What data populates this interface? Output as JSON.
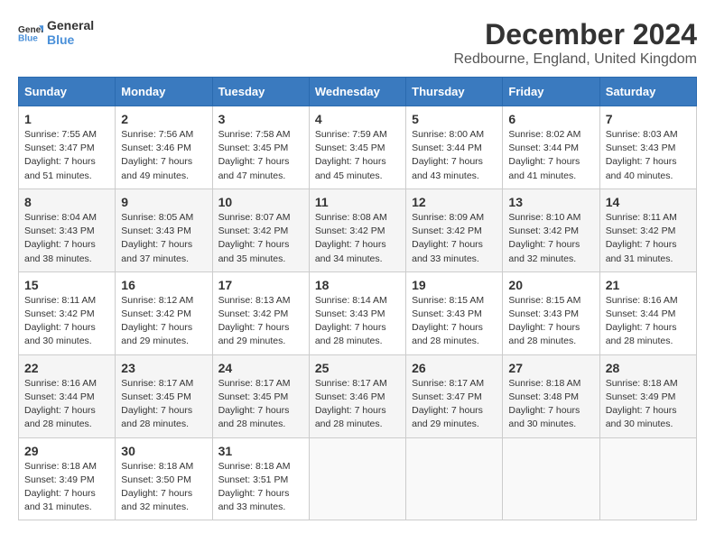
{
  "header": {
    "logo_general": "General",
    "logo_blue": "Blue",
    "month_title": "December 2024",
    "location": "Redbourne, England, United Kingdom"
  },
  "calendar": {
    "days_of_week": [
      "Sunday",
      "Monday",
      "Tuesday",
      "Wednesday",
      "Thursday",
      "Friday",
      "Saturday"
    ],
    "weeks": [
      [
        null,
        {
          "day": "2",
          "sunrise": "7:56 AM",
          "sunset": "3:46 PM",
          "daylight": "7 hours and 49 minutes."
        },
        {
          "day": "3",
          "sunrise": "7:58 AM",
          "sunset": "3:45 PM",
          "daylight": "7 hours and 47 minutes."
        },
        {
          "day": "4",
          "sunrise": "7:59 AM",
          "sunset": "3:45 PM",
          "daylight": "7 hours and 45 minutes."
        },
        {
          "day": "5",
          "sunrise": "8:00 AM",
          "sunset": "3:44 PM",
          "daylight": "7 hours and 43 minutes."
        },
        {
          "day": "6",
          "sunrise": "8:02 AM",
          "sunset": "3:44 PM",
          "daylight": "7 hours and 41 minutes."
        },
        {
          "day": "7",
          "sunrise": "8:03 AM",
          "sunset": "3:43 PM",
          "daylight": "7 hours and 40 minutes."
        }
      ],
      [
        {
          "day": "1",
          "sunrise": "7:55 AM",
          "sunset": "3:47 PM",
          "daylight": "7 hours and 51 minutes."
        },
        {
          "day": "8",
          "sunrise": "8:04 AM",
          "sunset": "3:43 PM",
          "daylight": "7 hours and 38 minutes."
        },
        {
          "day": "9",
          "sunrise": "8:05 AM",
          "sunset": "3:43 PM",
          "daylight": "7 hours and 37 minutes."
        },
        {
          "day": "10",
          "sunrise": "8:07 AM",
          "sunset": "3:42 PM",
          "daylight": "7 hours and 35 minutes."
        },
        {
          "day": "11",
          "sunrise": "8:08 AM",
          "sunset": "3:42 PM",
          "daylight": "7 hours and 34 minutes."
        },
        {
          "day": "12",
          "sunrise": "8:09 AM",
          "sunset": "3:42 PM",
          "daylight": "7 hours and 33 minutes."
        },
        {
          "day": "13",
          "sunrise": "8:10 AM",
          "sunset": "3:42 PM",
          "daylight": "7 hours and 32 minutes."
        },
        {
          "day": "14",
          "sunrise": "8:11 AM",
          "sunset": "3:42 PM",
          "daylight": "7 hours and 31 minutes."
        }
      ],
      [
        {
          "day": "15",
          "sunrise": "8:11 AM",
          "sunset": "3:42 PM",
          "daylight": "7 hours and 30 minutes."
        },
        {
          "day": "16",
          "sunrise": "8:12 AM",
          "sunset": "3:42 PM",
          "daylight": "7 hours and 29 minutes."
        },
        {
          "day": "17",
          "sunrise": "8:13 AM",
          "sunset": "3:42 PM",
          "daylight": "7 hours and 29 minutes."
        },
        {
          "day": "18",
          "sunrise": "8:14 AM",
          "sunset": "3:43 PM",
          "daylight": "7 hours and 28 minutes."
        },
        {
          "day": "19",
          "sunrise": "8:15 AM",
          "sunset": "3:43 PM",
          "daylight": "7 hours and 28 minutes."
        },
        {
          "day": "20",
          "sunrise": "8:15 AM",
          "sunset": "3:43 PM",
          "daylight": "7 hours and 28 minutes."
        },
        {
          "day": "21",
          "sunrise": "8:16 AM",
          "sunset": "3:44 PM",
          "daylight": "7 hours and 28 minutes."
        }
      ],
      [
        {
          "day": "22",
          "sunrise": "8:16 AM",
          "sunset": "3:44 PM",
          "daylight": "7 hours and 28 minutes."
        },
        {
          "day": "23",
          "sunrise": "8:17 AM",
          "sunset": "3:45 PM",
          "daylight": "7 hours and 28 minutes."
        },
        {
          "day": "24",
          "sunrise": "8:17 AM",
          "sunset": "3:45 PM",
          "daylight": "7 hours and 28 minutes."
        },
        {
          "day": "25",
          "sunrise": "8:17 AM",
          "sunset": "3:46 PM",
          "daylight": "7 hours and 28 minutes."
        },
        {
          "day": "26",
          "sunrise": "8:17 AM",
          "sunset": "3:47 PM",
          "daylight": "7 hours and 29 minutes."
        },
        {
          "day": "27",
          "sunrise": "8:18 AM",
          "sunset": "3:48 PM",
          "daylight": "7 hours and 30 minutes."
        },
        {
          "day": "28",
          "sunrise": "8:18 AM",
          "sunset": "3:49 PM",
          "daylight": "7 hours and 30 minutes."
        }
      ],
      [
        {
          "day": "29",
          "sunrise": "8:18 AM",
          "sunset": "3:49 PM",
          "daylight": "7 hours and 31 minutes."
        },
        {
          "day": "30",
          "sunrise": "8:18 AM",
          "sunset": "3:50 PM",
          "daylight": "7 hours and 32 minutes."
        },
        {
          "day": "31",
          "sunrise": "8:18 AM",
          "sunset": "3:51 PM",
          "daylight": "7 hours and 33 minutes."
        },
        null,
        null,
        null,
        null
      ]
    ]
  }
}
